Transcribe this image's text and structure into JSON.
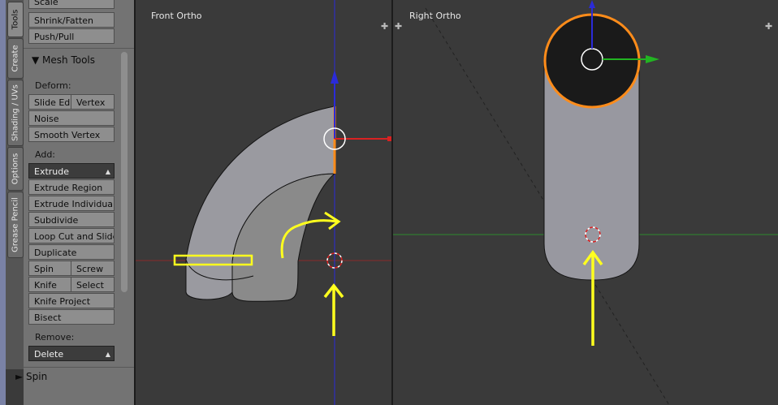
{
  "tabs": [
    {
      "label": "Tools",
      "active": true
    },
    {
      "label": "Create",
      "active": false
    },
    {
      "label": "Shading / UVs",
      "active": false
    },
    {
      "label": "Options",
      "active": false
    },
    {
      "label": "Grease Pencil",
      "active": false
    }
  ],
  "toolshelf": {
    "top_buttons": [
      "Scale",
      "Shrink/Fatten",
      "Push/Pull"
    ],
    "panel_title": "Mesh Tools",
    "deform": {
      "label": "Deform:",
      "slide_edge": "Slide Ed",
      "vertex": "Vertex",
      "noise": "Noise",
      "smooth_vertex": "Smooth Vertex"
    },
    "add": {
      "label": "Add:",
      "extrude_select": "Extrude",
      "extrude_region": "Extrude Region",
      "extrude_individual": "Extrude Individual",
      "subdivide": "Subdivide",
      "loop_cut": "Loop Cut and Slide",
      "duplicate": "Duplicate",
      "spin": "Spin",
      "screw": "Screw",
      "knife": "Knife",
      "select": "Select",
      "knife_project": "Knife Project",
      "bisect": "Bisect"
    },
    "remove": {
      "label": "Remove:",
      "delete_select": "Delete"
    },
    "operator_panel": "Spin"
  },
  "viewports": [
    {
      "title": "Front Ortho"
    },
    {
      "title": "Right Ortho"
    }
  ],
  "colors": {
    "accent_blue": "#2b2bd9",
    "axis_red": "#d92222",
    "axis_green": "#22b422",
    "selection_orange": "#ff8c1a",
    "annotation_yellow": "#ffff1e"
  }
}
